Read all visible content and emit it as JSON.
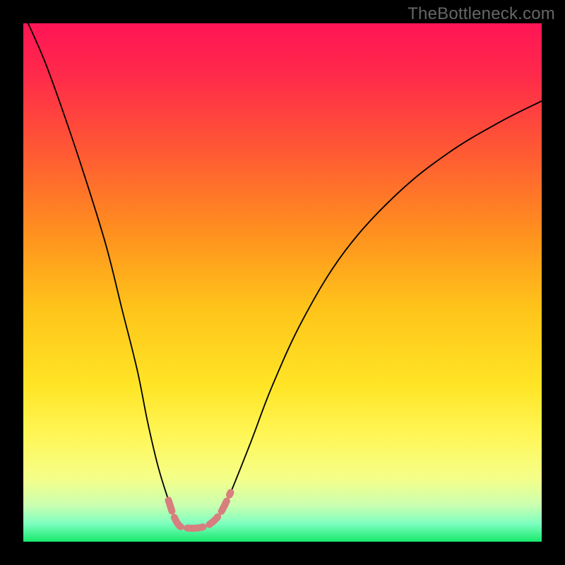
{
  "watermark": "TheBottleneck.com",
  "chart_data": {
    "type": "line",
    "title": "",
    "xlabel": "",
    "ylabel": "",
    "xlim": [
      0,
      100
    ],
    "ylim": [
      0,
      100
    ],
    "curve": {
      "name": "bottleneck-curve",
      "x": [
        0,
        4,
        8,
        12,
        16,
        19,
        22,
        24,
        26,
        28,
        29,
        30,
        31,
        32.5,
        34,
        36,
        38,
        40,
        44,
        48,
        54,
        62,
        72,
        82,
        92,
        100
      ],
      "y": [
        102,
        93,
        82,
        70,
        57,
        45,
        33,
        23,
        14.5,
        8,
        5,
        3.2,
        2.7,
        2.6,
        2.7,
        3.4,
        5.5,
        9.5,
        19.5,
        30,
        43,
        56,
        67,
        75,
        81,
        85
      ]
    },
    "bottom_band": {
      "name": "green-band",
      "y_start": 0,
      "y_end": 2.6
    },
    "line_stroke": "#000000",
    "accent_stroke": "#d77e7e",
    "gradient_stops": [
      {
        "offset": 0.0,
        "color": "#ff1556"
      },
      {
        "offset": 0.1,
        "color": "#ff2a4a"
      },
      {
        "offset": 0.25,
        "color": "#ff5a33"
      },
      {
        "offset": 0.4,
        "color": "#ff8f1f"
      },
      {
        "offset": 0.55,
        "color": "#ffc41a"
      },
      {
        "offset": 0.7,
        "color": "#ffe526"
      },
      {
        "offset": 0.8,
        "color": "#fff75a"
      },
      {
        "offset": 0.88,
        "color": "#f4ff8a"
      },
      {
        "offset": 0.93,
        "color": "#caffb0"
      },
      {
        "offset": 0.965,
        "color": "#7dffc0"
      },
      {
        "offset": 1.0,
        "color": "#18e86b"
      }
    ]
  }
}
